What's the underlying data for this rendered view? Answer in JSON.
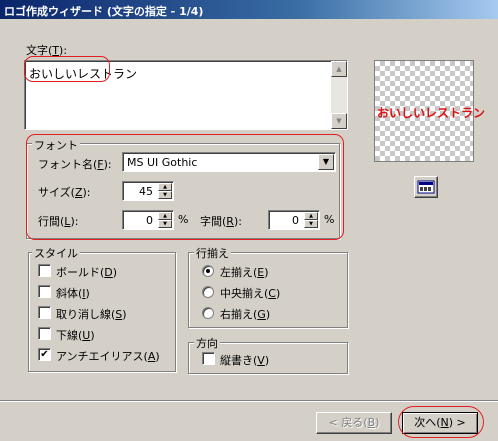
{
  "window": {
    "title": "ロゴ作成ウィザード (文字の指定 - 1/4)"
  },
  "text_section": {
    "label": "文字(",
    "mnemonic": "T",
    "label_end": "):",
    "value": "おいしいレストラン"
  },
  "font_group": {
    "title": "フォント",
    "font_name": {
      "label": "フォント名(",
      "mnemonic": "F",
      "label_end": "):",
      "value": "MS UI Gothic"
    },
    "size": {
      "label": "サイズ(",
      "mnemonic": "Z",
      "label_end": "):",
      "value": "45"
    },
    "line_spacing": {
      "label": "行間(",
      "mnemonic": "L",
      "label_end": "):",
      "value": "0",
      "unit": "%"
    },
    "char_spacing": {
      "label": "字間(",
      "mnemonic": "R",
      "label_end": "):",
      "value": "0",
      "unit": "%"
    }
  },
  "style_group": {
    "title": "スタイル",
    "items": [
      {
        "label": "ボールド(",
        "mnemonic": "D",
        "label_end": ")",
        "checked": false
      },
      {
        "label": "斜体(",
        "mnemonic": "I",
        "label_end": ")",
        "checked": false
      },
      {
        "label": "取り消し線(",
        "mnemonic": "S",
        "label_end": ")",
        "checked": false
      },
      {
        "label": "下線(",
        "mnemonic": "U",
        "label_end": ")",
        "checked": false
      },
      {
        "label": "アンチエイリアス(",
        "mnemonic": "A",
        "label_end": ")",
        "checked": true
      }
    ]
  },
  "align_group": {
    "title": "行揃え",
    "items": [
      {
        "label": "左揃え(",
        "mnemonic": "E",
        "label_end": ")",
        "selected": true
      },
      {
        "label": "中央揃え(",
        "mnemonic": "C",
        "label_end": ")",
        "selected": false
      },
      {
        "label": "右揃え(",
        "mnemonic": "G",
        "label_end": ")",
        "selected": false
      }
    ]
  },
  "direction_group": {
    "title": "方向",
    "vertical": {
      "label": "縦書き(",
      "mnemonic": "V",
      "label_end": ")",
      "checked": false
    }
  },
  "preview": {
    "text": "おいしいレストラン",
    "text_color": "#e01010",
    "font_button_icon": "abc-font-icon"
  },
  "buttons": {
    "back": {
      "label": "< 戻る(",
      "mnemonic": "B",
      "label_end": ")",
      "disabled": true
    },
    "next": {
      "label": "次へ(",
      "mnemonic": "N",
      "label_end": ") >"
    }
  },
  "colors": {
    "annotation_ring": "#e02020",
    "titlebar_start": "#0a246a"
  }
}
